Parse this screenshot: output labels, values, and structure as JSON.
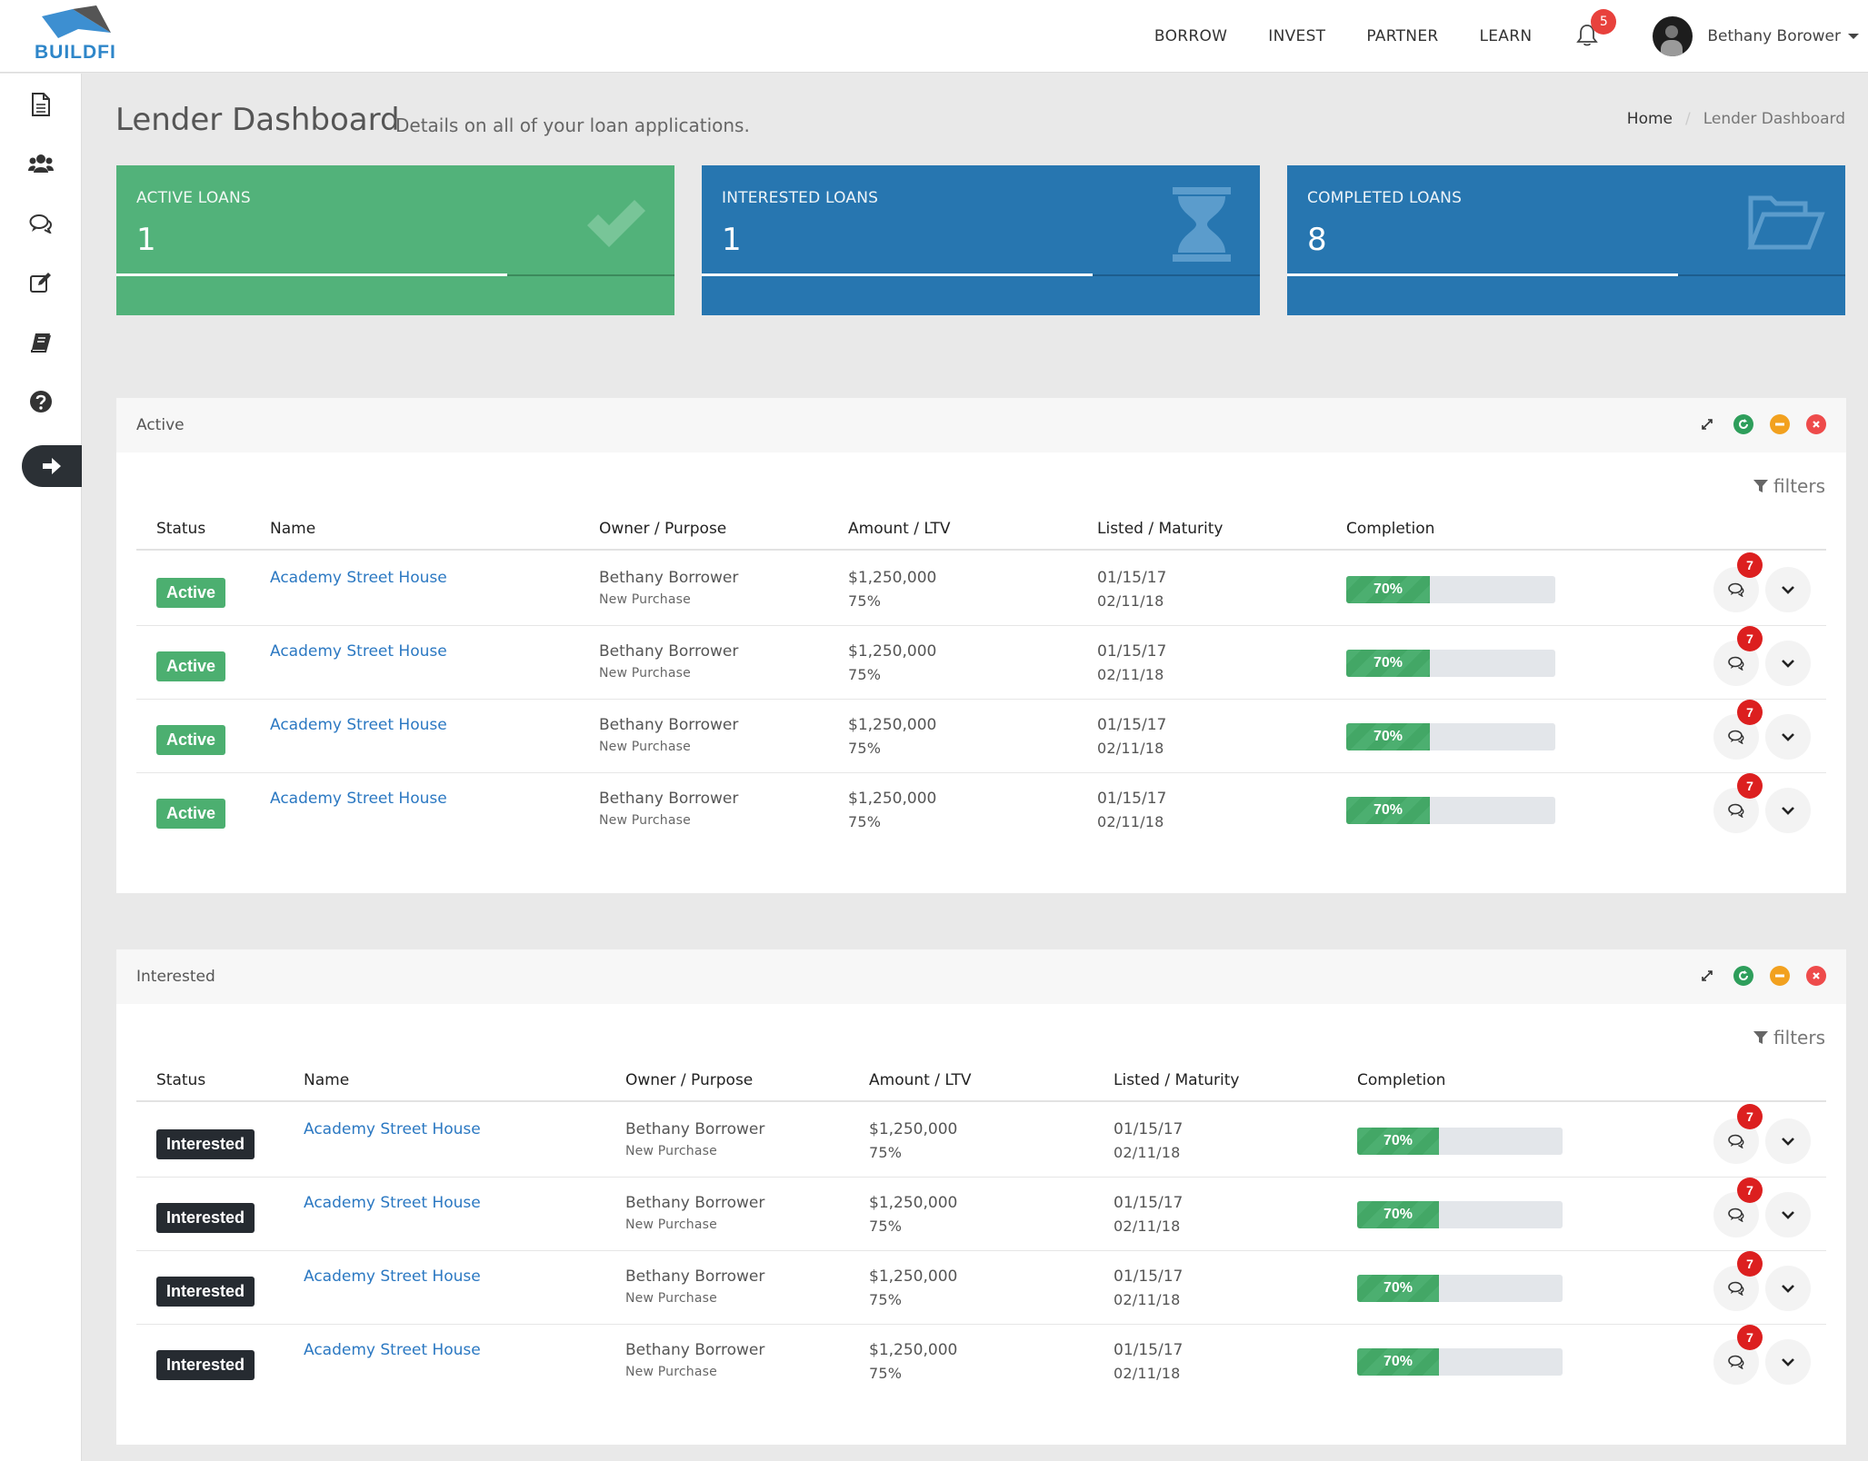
{
  "brand": {
    "name": "BUILDFI"
  },
  "nav": {
    "links": [
      "BORROW",
      "INVEST",
      "PARTNER",
      "LEARN"
    ],
    "notifications_count": "5",
    "user_name": "Bethany Borower"
  },
  "sidebar": {
    "items": [
      "document-icon",
      "users-icon",
      "comments-icon",
      "edit-icon",
      "book-icon",
      "help-icon",
      "arrow-right-icon"
    ]
  },
  "page": {
    "title": "Lender Dashboard",
    "subtitle": "Details on all of your loan applications.",
    "breadcrumb": [
      "Home",
      "Lender Dashboard"
    ]
  },
  "stats": [
    {
      "label": "ACTIVE LOANS",
      "value": "1",
      "color": "#52b27a",
      "icon": "check-icon",
      "progress": 0.7
    },
    {
      "label": "INTERESTED LOANS",
      "value": "1",
      "color": "#2776b0",
      "icon": "hourglass-icon",
      "progress": 0.7
    },
    {
      "label": "COMPLETED LOANS",
      "value": "8",
      "color": "#2776b0",
      "icon": "folder-open-icon",
      "progress": 0.7
    }
  ],
  "panels": {
    "active": {
      "title": "Active",
      "filters_label": "filters",
      "columns": [
        "Status",
        "Name",
        "Owner / Purpose",
        "Amount / LTV",
        "Listed / Maturity",
        "Completion"
      ],
      "rows": [
        {
          "status": "Active",
          "name": "Academy Street House",
          "owner": "Bethany Borrower",
          "purpose": "New Purchase",
          "amount": "$1,250,000",
          "ltv": "75%",
          "listed": "01/15/17",
          "maturity": "02/11/18",
          "completion": "70%",
          "messages": "7"
        },
        {
          "status": "Active",
          "name": "Academy Street House",
          "owner": "Bethany Borrower",
          "purpose": "New Purchase",
          "amount": "$1,250,000",
          "ltv": "75%",
          "listed": "01/15/17",
          "maturity": "02/11/18",
          "completion": "70%",
          "messages": "7"
        },
        {
          "status": "Active",
          "name": "Academy Street House",
          "owner": "Bethany Borrower",
          "purpose": "New Purchase",
          "amount": "$1,250,000",
          "ltv": "75%",
          "listed": "01/15/17",
          "maturity": "02/11/18",
          "completion": "70%",
          "messages": "7"
        },
        {
          "status": "Active",
          "name": "Academy Street House",
          "owner": "Bethany Borrower",
          "purpose": "New Purchase",
          "amount": "$1,250,000",
          "ltv": "75%",
          "listed": "01/15/17",
          "maturity": "02/11/18",
          "completion": "70%",
          "messages": "7"
        }
      ]
    },
    "interested": {
      "title": "Interested",
      "filters_label": "filters",
      "columns": [
        "Status",
        "Name",
        "Owner / Purpose",
        "Amount / LTV",
        "Listed / Maturity",
        "Completion"
      ],
      "rows": [
        {
          "status": "Interested",
          "name": "Academy Street House",
          "owner": "Bethany Borrower",
          "purpose": "New Purchase",
          "amount": "$1,250,000",
          "ltv": "75%",
          "listed": "01/15/17",
          "maturity": "02/11/18",
          "completion": "70%",
          "messages": "7"
        },
        {
          "status": "Interested",
          "name": "Academy Street House",
          "owner": "Bethany Borrower",
          "purpose": "New Purchase",
          "amount": "$1,250,000",
          "ltv": "75%",
          "listed": "01/15/17",
          "maturity": "02/11/18",
          "completion": "70%",
          "messages": "7"
        },
        {
          "status": "Interested",
          "name": "Academy Street House",
          "owner": "Bethany Borrower",
          "purpose": "New Purchase",
          "amount": "$1,250,000",
          "ltv": "75%",
          "listed": "01/15/17",
          "maturity": "02/11/18",
          "completion": "70%",
          "messages": "7"
        },
        {
          "status": "Interested",
          "name": "Academy Street House",
          "owner": "Bethany Borrower",
          "purpose": "New Purchase",
          "amount": "$1,250,000",
          "ltv": "75%",
          "listed": "01/15/17",
          "maturity": "02/11/18",
          "completion": "70%",
          "messages": "7"
        }
      ]
    }
  },
  "colors": {
    "success": "#4caf70",
    "primary": "#2776b0",
    "dark": "#262b31",
    "link": "#2b78c2",
    "danger": "#dc1f1f",
    "warning": "#f2a11f"
  }
}
